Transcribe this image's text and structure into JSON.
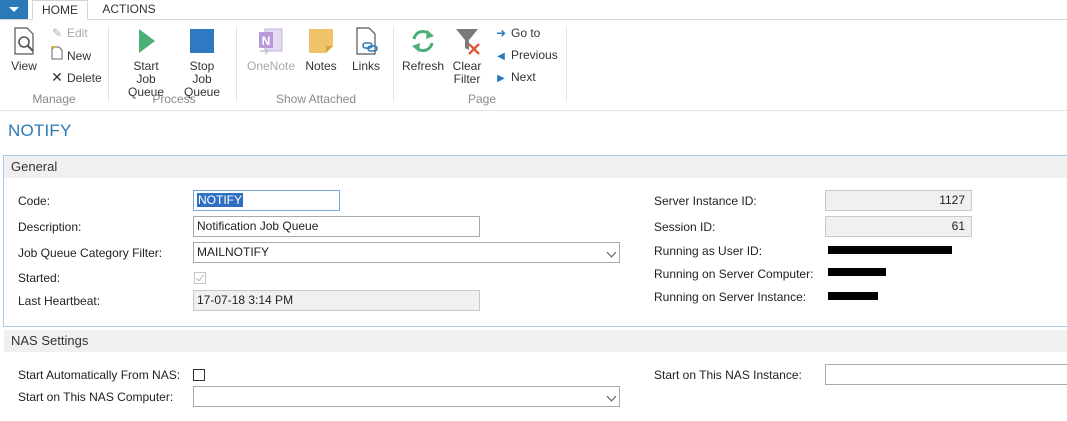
{
  "tabs": {
    "home": "HOME",
    "actions": "ACTIONS"
  },
  "ribbon": {
    "view": "View",
    "edit": "Edit",
    "new": "New",
    "delete": "Delete",
    "manage_group": "Manage",
    "start_job_queue": "Start Job Queue",
    "stop_job_queue": "Stop Job Queue",
    "process_group": "Process",
    "onenote": "OneNote",
    "notes": "Notes",
    "links": "Links",
    "show_attached_group": "Show Attached",
    "refresh": "Refresh",
    "clear_filter": "Clear Filter",
    "go_to": "Go to",
    "previous": "Previous",
    "next": "Next",
    "page_group": "Page"
  },
  "page": {
    "title": "NOTIFY"
  },
  "general": {
    "header": "General",
    "code_label": "Code:",
    "code_value": "NOTIFY",
    "description_label": "Description:",
    "description_value": "Notification Job Queue",
    "category_label": "Job Queue Category Filter:",
    "category_value": "MAILNOTIFY",
    "started_label": "Started:",
    "heartbeat_label": "Last Heartbeat:",
    "heartbeat_value": "17-07-18 3:14 PM",
    "server_instance_id_label": "Server Instance ID:",
    "server_instance_id_value": "1127",
    "session_id_label": "Session ID:",
    "session_id_value": "61",
    "running_user_label": "Running as User ID:",
    "running_computer_label": "Running on Server Computer:",
    "running_instance_label": "Running on Server Instance:"
  },
  "nas": {
    "header": "NAS Settings",
    "auto_start_label": "Start Automatically From NAS:",
    "computer_label": "Start on This NAS Computer:",
    "computer_value": "",
    "instance_label": "Start on This NAS Instance:",
    "instance_value": ""
  },
  "colors": {
    "accent": "#2a7ab8",
    "play": "#4caf78",
    "stop": "#2f79c2",
    "notes": "#f0c36b",
    "onenote": "#9c78c9"
  }
}
